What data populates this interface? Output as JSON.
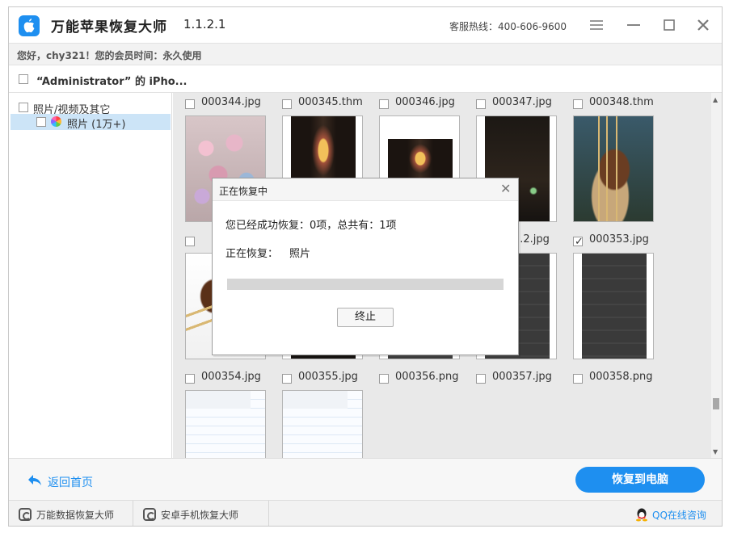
{
  "app": {
    "title": "万能苹果恢复大师",
    "version": "1.1.2.1",
    "hotline": "客服热线：400-606-9600",
    "accent_color": "#1e8ff0"
  },
  "member_info": "您好，chy321！您的会员时间：永久使用",
  "device": {
    "name": "“Administrator” 的 iPho..."
  },
  "tree": {
    "root_label": "照片/视频及其它",
    "child_label": "照片 (1万+)",
    "child_icon": "photos-icon"
  },
  "grid": {
    "top_row_files": [
      "000344.jpg",
      "000345.thm",
      "000346.jpg",
      "000347.jpg",
      "000348.thm"
    ],
    "row1_files": [
      "",
      "",
      "",
      "...2.jpg",
      "000353.jpg"
    ],
    "row1_checked": [
      false,
      false,
      false,
      false,
      true
    ],
    "row2_files": [
      "000354.jpg",
      "000355.jpg",
      "000356.png",
      "000357.jpg",
      "000358.png"
    ]
  },
  "dialog": {
    "title": "正在恢复中",
    "status": "您已经成功恢复：0项，总共有：1项",
    "now_label": "正在恢复：",
    "now_value": "照片",
    "progress": 0,
    "stop_label": "终止"
  },
  "actions": {
    "back_label": "返回首页",
    "recover_label": "恢复到电脑"
  },
  "footer": {
    "item1": "万能数据恢复大师",
    "item2": "安卓手机恢复大师",
    "qq": "QQ在线咨询"
  }
}
